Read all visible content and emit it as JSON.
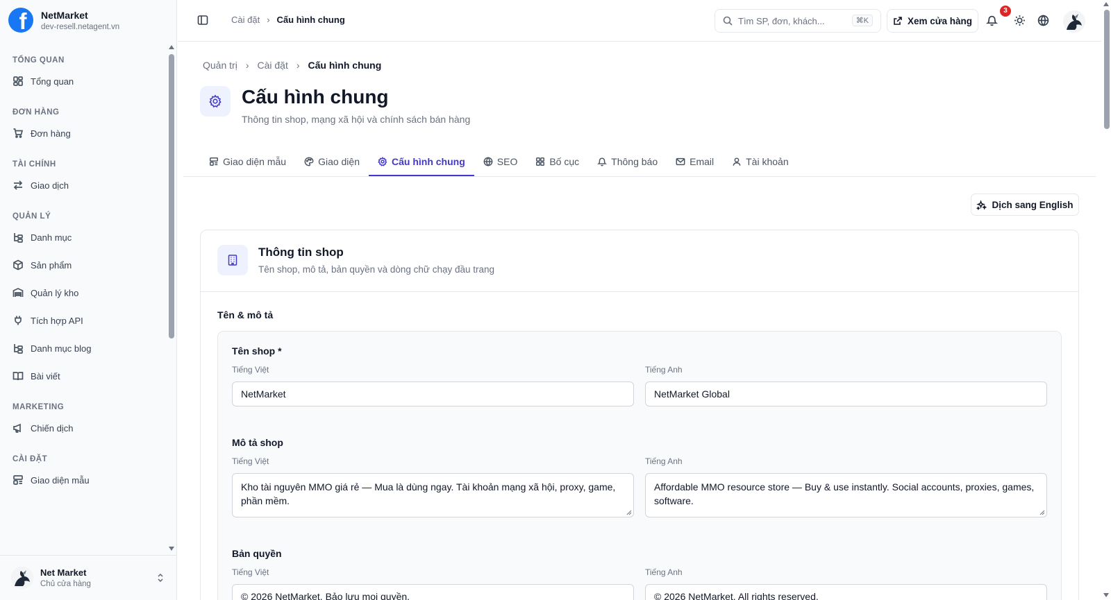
{
  "brand": {
    "name": "NetMarket",
    "domain": "dev-resell.netagent.vn",
    "logo_letter": "f",
    "color": "#1877f2"
  },
  "sidebar": {
    "sections": [
      {
        "title": "TỔNG QUAN",
        "items": [
          {
            "label": "Tổng quan",
            "icon": "dashboard-icon"
          }
        ]
      },
      {
        "title": "ĐƠN HÀNG",
        "items": [
          {
            "label": "Đơn hàng",
            "icon": "cart-icon"
          }
        ]
      },
      {
        "title": "TÀI CHÍNH",
        "items": [
          {
            "label": "Giao dịch",
            "icon": "transfer-icon"
          }
        ]
      },
      {
        "title": "QUẢN LÝ",
        "items": [
          {
            "label": "Danh mục",
            "icon": "tree-icon"
          },
          {
            "label": "Sản phẩm",
            "icon": "box-icon"
          },
          {
            "label": "Quản lý kho",
            "icon": "warehouse-icon"
          },
          {
            "label": "Tích hợp API",
            "icon": "plug-icon"
          },
          {
            "label": "Danh mục blog",
            "icon": "tree-icon"
          },
          {
            "label": "Bài viết",
            "icon": "book-icon"
          }
        ]
      },
      {
        "title": "MARKETING",
        "items": [
          {
            "label": "Chiến dịch",
            "icon": "megaphone-icon"
          }
        ]
      },
      {
        "title": "CÀI ĐẶT",
        "items": [
          {
            "label": "Giao diện mẫu",
            "icon": "template-icon"
          }
        ]
      }
    ]
  },
  "user": {
    "name": "Net Market",
    "role": "Chủ cửa hàng"
  },
  "topbar": {
    "breadcrumb": [
      "Cài đặt",
      "Cấu hình chung"
    ],
    "search_placeholder": "Tìm SP, đơn, khách...",
    "shortcut": "⌘K",
    "store_button": "Xem cửa hàng",
    "notification_count": "3"
  },
  "page": {
    "breadcrumb": [
      "Quản trị",
      "Cài đặt",
      "Cấu hình chung"
    ],
    "title": "Cấu hình chung",
    "subtitle": "Thông tin shop, mạng xã hội và chính sách bán hàng",
    "accent": "#4338ca"
  },
  "tabs": [
    {
      "label": "Giao diện mẫu",
      "icon": "template-icon",
      "active": false
    },
    {
      "label": "Giao diện",
      "icon": "palette-icon",
      "active": false
    },
    {
      "label": "Cấu hình chung",
      "icon": "gear-icon",
      "active": true
    },
    {
      "label": "SEO",
      "icon": "globe-icon",
      "active": false
    },
    {
      "label": "Bố cục",
      "icon": "grid-icon",
      "active": false
    },
    {
      "label": "Thông báo",
      "icon": "bell-icon",
      "active": false
    },
    {
      "label": "Email",
      "icon": "mail-icon",
      "active": false
    },
    {
      "label": "Tài khoản",
      "icon": "user-icon",
      "active": false
    }
  ],
  "translate_button": "Dịch sang English",
  "card": {
    "title": "Thông tin shop",
    "subtitle": "Tên shop, mô tả, bản quyền và dòng chữ chạy đầu trang",
    "group_title": "Tên & mô tả",
    "lang_vi": "Tiếng Việt",
    "lang_en": "Tiếng Anh",
    "fields": {
      "name": {
        "label": "Tên shop *",
        "vi": "NetMarket",
        "en": "NetMarket Global"
      },
      "description": {
        "label": "Mô tả shop",
        "vi": "Kho tài nguyên MMO giá rẻ — Mua là dùng ngay. Tài khoản mạng xã hội, proxy, game, phần mềm.",
        "en": "Affordable MMO resource store — Buy & use instantly. Social accounts, proxies, games, software."
      },
      "copyright": {
        "label": "Bản quyền",
        "vi": "© 2026 NetMarket. Bảo lưu mọi quyền.",
        "en": "© 2026 NetMarket. All rights reserved."
      }
    }
  }
}
